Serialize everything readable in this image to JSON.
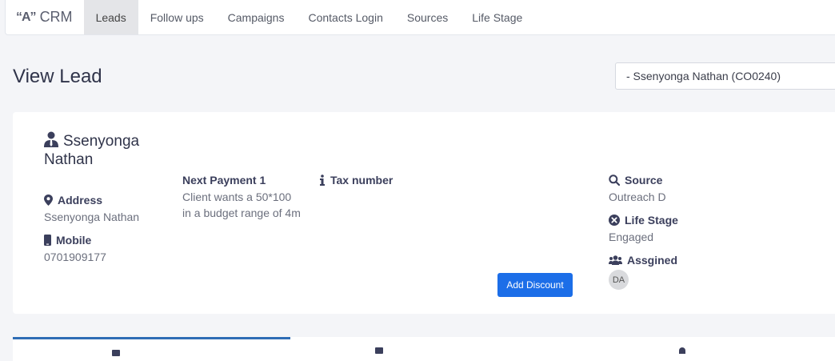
{
  "nav": {
    "brand": "CRM",
    "items": [
      {
        "label": "Leads",
        "active": true
      },
      {
        "label": "Follow ups"
      },
      {
        "label": "Campaigns"
      },
      {
        "label": "Contacts Login"
      },
      {
        "label": "Sources"
      },
      {
        "label": "Life Stage"
      }
    ]
  },
  "header": {
    "title": "View Lead",
    "selected_lead": "- Ssenyonga Nathan (CO0240)"
  },
  "lead": {
    "name": "Ssenyonga Nathan",
    "address_label": "Address",
    "address": "Ssenyonga Nathan",
    "mobile_label": "Mobile",
    "mobile": "0701909177",
    "payment_label": "Next Payment 1",
    "payment_note": "Client wants a 50*100 in a budget range of 4m",
    "tax_label": "Tax number",
    "source_label": "Source",
    "source": "Outreach D",
    "stage_label": "Life Stage",
    "stage": "Engaged",
    "assigned_label": "Assgined",
    "assigned_initials": "DA",
    "discount_button": "Add Discount"
  },
  "icons": [
    "crm-logo-icon",
    "user-tie-icon",
    "map-marker-icon",
    "mobile-icon",
    "info-icon",
    "search-icon",
    "times-circle-icon",
    "users-icon"
  ],
  "colors": {
    "primary_button": "#1c6ee8",
    "active_tab": "#2f6db5"
  }
}
